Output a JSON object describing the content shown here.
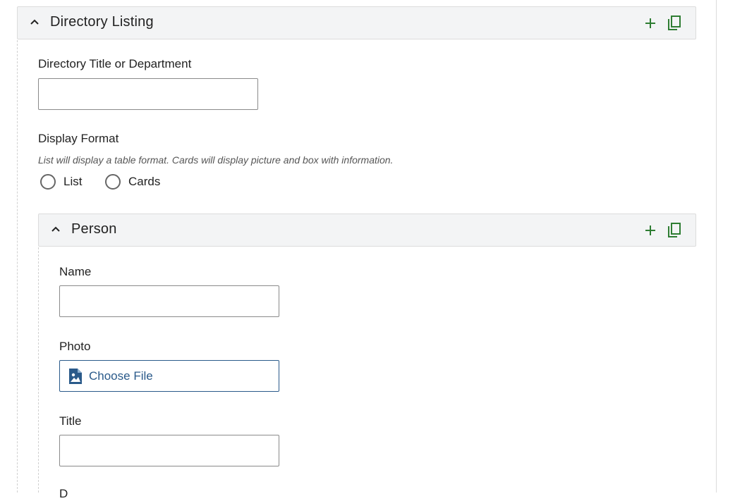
{
  "directory": {
    "title": "Directory Listing",
    "icons": {
      "collapse": "chevron-up-icon",
      "add": "plus-icon",
      "duplicate": "copy-icon"
    },
    "fields": {
      "title_label": "Directory Title or Department",
      "title_value": "",
      "format_label": "Display Format",
      "format_hint": "List will display a table format. Cards will display picture and box with information.",
      "format_options": [
        "List",
        "Cards"
      ]
    }
  },
  "person": {
    "title": "Person",
    "icons": {
      "collapse": "chevron-up-icon",
      "add": "plus-icon",
      "duplicate": "copy-icon"
    },
    "fields": {
      "name_label": "Name",
      "name_value": "",
      "photo_label": "Photo",
      "photo_button": "Choose File",
      "photo_icon": "image-file-icon",
      "title_label": "Title",
      "title_value": "",
      "next_label": "D"
    }
  },
  "colors": {
    "accent_green": "#2e7d32",
    "link_blue": "#2a5a8a",
    "header_bg": "#f3f4f5"
  }
}
